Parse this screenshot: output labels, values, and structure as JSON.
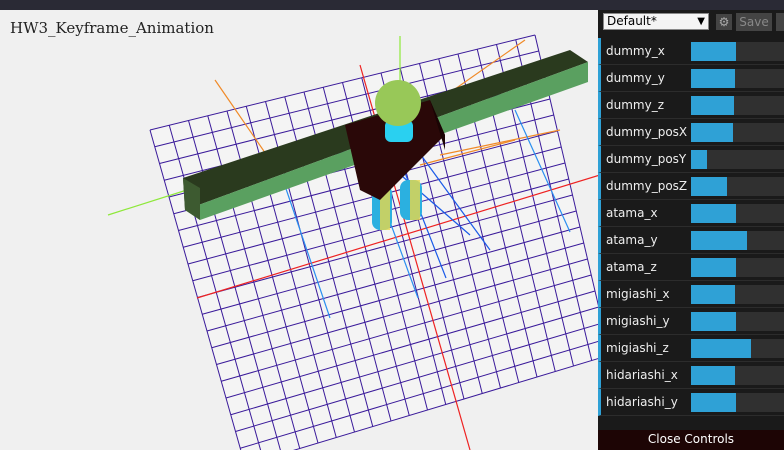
{
  "viewport": {
    "title": "HW3_Keyframe_Animation"
  },
  "gui": {
    "preset": "Default*",
    "save_label": "Save",
    "close_label": "Close Controls",
    "controllers": [
      {
        "label": "dummy_x",
        "value": 0.47
      },
      {
        "label": "dummy_y",
        "value": 0.46
      },
      {
        "label": "dummy_z",
        "value": 0.45
      },
      {
        "label": "dummy_posX",
        "value": 0.44
      },
      {
        "label": "dummy_posY",
        "value": 0.17
      },
      {
        "label": "dummy_posZ",
        "value": 0.37
      },
      {
        "label": "atama_x",
        "value": 0.47
      },
      {
        "label": "atama_y",
        "value": 0.58
      },
      {
        "label": "atama_z",
        "value": 0.47
      },
      {
        "label": "migiashi_x",
        "value": 0.46
      },
      {
        "label": "migiashi_y",
        "value": 0.47
      },
      {
        "label": "migiashi_z",
        "value": 0.63
      },
      {
        "label": "hidariashi_x",
        "value": 0.46
      },
      {
        "label": "hidariashi_y",
        "value": 0.47
      }
    ]
  },
  "colors": {
    "accent": "#2fa1d6",
    "grid": "#3a1a9a"
  }
}
